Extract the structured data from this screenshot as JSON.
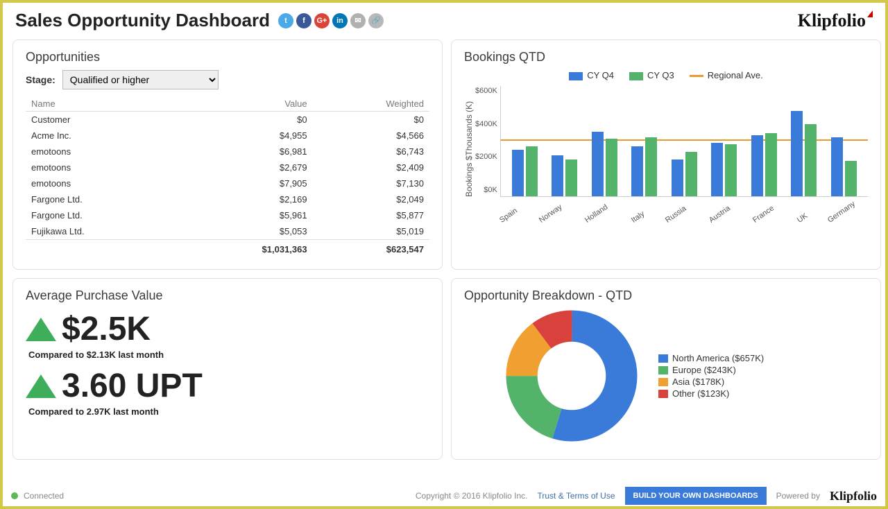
{
  "header": {
    "title": "Sales Opportunity Dashboard",
    "brand": "Klipfolio"
  },
  "opportunities": {
    "title": "Opportunities",
    "stage_label": "Stage:",
    "stage_selected": "Qualified or higher",
    "columns": {
      "name": "Name",
      "value": "Value",
      "weighted": "Weighted"
    },
    "rows": [
      {
        "name": "Customer",
        "value": "$0",
        "weighted": "$0"
      },
      {
        "name": "Acme Inc.",
        "value": "$4,955",
        "weighted": "$4,566"
      },
      {
        "name": "emotoons",
        "value": "$6,981",
        "weighted": "$6,743"
      },
      {
        "name": "emotoons",
        "value": "$2,679",
        "weighted": "$2,409"
      },
      {
        "name": "emotoons",
        "value": "$7,905",
        "weighted": "$7,130"
      },
      {
        "name": "Fargone Ltd.",
        "value": "$2,169",
        "weighted": "$2,049"
      },
      {
        "name": "Fargone Ltd.",
        "value": "$5,961",
        "weighted": "$5,877"
      },
      {
        "name": "Fujikawa Ltd.",
        "value": "$5,053",
        "weighted": "$5,019"
      }
    ],
    "totals": {
      "value": "$1,031,363",
      "weighted": "$623,547"
    }
  },
  "bookings": {
    "title": "Bookings QTD",
    "legend": {
      "cy": "CY Q4",
      "pq": "CY Q3",
      "reg": "Regional Ave."
    },
    "ylabel": "Bookings $Thousands (K)",
    "yticks": [
      "$600K",
      "$400K",
      "$200K",
      "$0K"
    ]
  },
  "apv": {
    "title": "Average Purchase Value",
    "v1": "$2.5K",
    "v1_sub": "Compared to $2.13K last month",
    "v2": "3.60 UPT",
    "v2_sub": "Compared to 2.97K last month"
  },
  "breakdown": {
    "title": "Opportunity Breakdown - QTD",
    "items": [
      {
        "label": "North America ($657K)",
        "color": "#3a7ad9"
      },
      {
        "label": "Europe ($243K)",
        "color": "#54b36a"
      },
      {
        "label": "Asia ($178K)",
        "color": "#f0a030"
      },
      {
        "label": "Other ($123K)",
        "color": "#d9413d"
      }
    ]
  },
  "footer": {
    "connected": "Connected",
    "copyright": "Copyright © 2016 Klipfolio Inc.",
    "trust": "Trust & Terms of Use",
    "build": "BUILD YOUR OWN DASHBOARDS",
    "powered": "Powered by",
    "brand": "Klipfolio"
  },
  "chart_data": [
    {
      "type": "bar",
      "title": "Bookings QTD",
      "ylabel": "Bookings $Thousands (K)",
      "ylim": [
        0,
        600
      ],
      "categories": [
        "Spain",
        "Norway",
        "Holland",
        "Italy",
        "Russia",
        "Austria",
        "France",
        "UK",
        "Germany"
      ],
      "series": [
        {
          "name": "CY Q4",
          "values": [
            250,
            220,
            350,
            270,
            200,
            290,
            330,
            460,
            320
          ]
        },
        {
          "name": "CY Q3",
          "values": [
            270,
            200,
            310,
            320,
            240,
            280,
            340,
            390,
            190
          ]
        }
      ],
      "reference_line": {
        "name": "Regional Ave.",
        "value": 310
      }
    },
    {
      "type": "pie",
      "title": "Opportunity Breakdown - QTD",
      "categories": [
        "North America",
        "Europe",
        "Asia",
        "Other"
      ],
      "values": [
        657,
        243,
        178,
        123
      ]
    }
  ]
}
